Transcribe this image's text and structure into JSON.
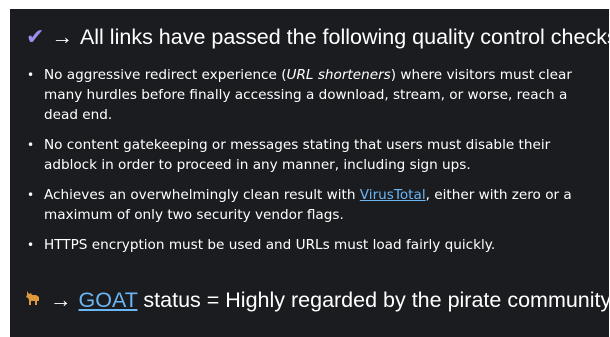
{
  "heading": {
    "icon": "check-icon",
    "arrow": "→",
    "text": "All links have passed the following quality control checks"
  },
  "checks": [
    {
      "before": "No aggressive redirect experience (",
      "emphasis": "URL shorteners",
      "after": ") where visitors must clear many hurdles before finally accessing a download, stream, or worse, reach a dead end."
    },
    {
      "text": "No content gatekeeping or messages stating that users must disable their adblock in order to proceed in any manner, including sign ups."
    },
    {
      "before": "Achieves an overwhelmingly clean result with ",
      "link": "VirusTotal",
      "after": ", either with zero or a maximum of only two security vendor flags."
    },
    {
      "text": "HTTPS encryption must be used and URLs must load fairly quickly."
    }
  ],
  "footer": {
    "icon": "goat-icon",
    "arrow": "→",
    "link": "GOAT",
    "text": " status = Highly regarded by the pirate community"
  },
  "colors": {
    "panel_bg": "#1b1c20",
    "text": "#ffffff",
    "link": "#6bb6f5",
    "check": "#9b8cf0"
  }
}
